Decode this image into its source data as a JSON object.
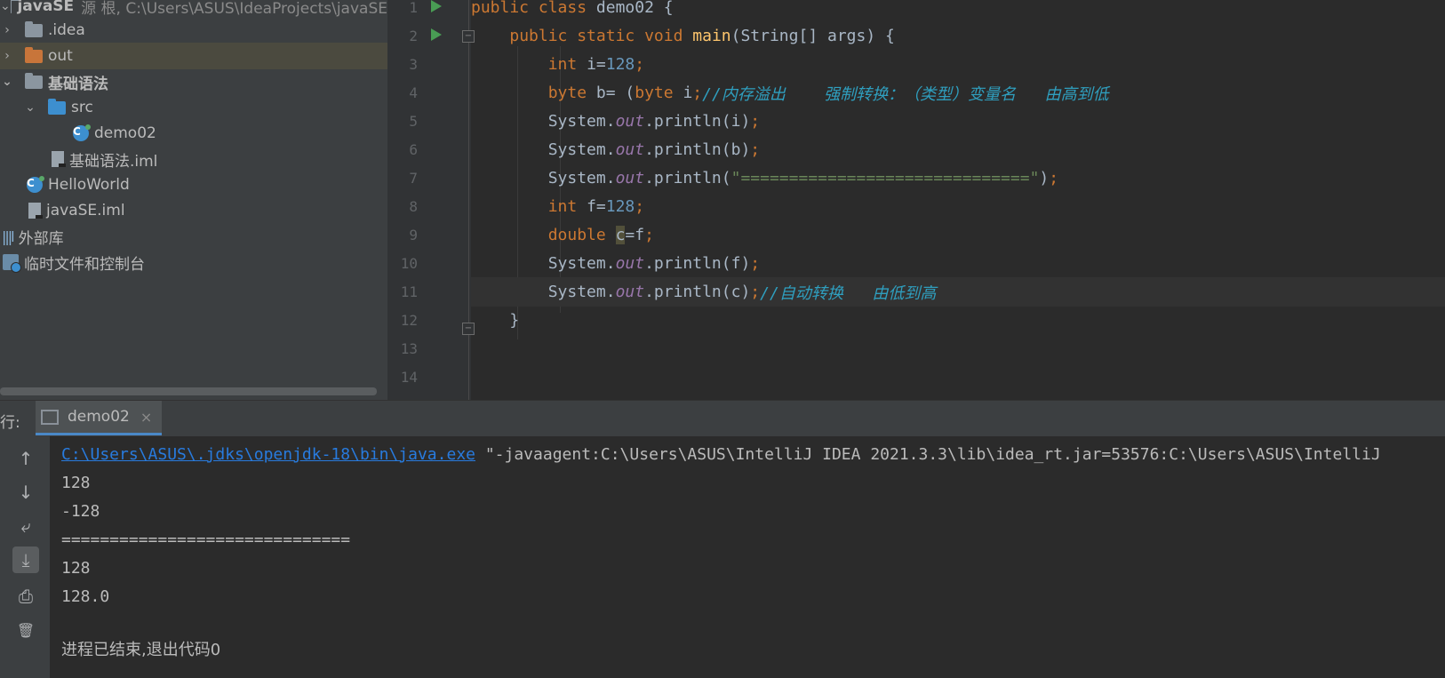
{
  "project_tree": {
    "root": {
      "name": "javaSE",
      "path": "源 根,  C:\\Users\\ASUS\\IdeaProjects\\javaSE"
    },
    "items": [
      {
        "label": ".idea"
      },
      {
        "label": "out"
      },
      {
        "label": "基础语法"
      },
      {
        "label": "src"
      },
      {
        "label": "demo02"
      },
      {
        "label": "基础语法.iml"
      },
      {
        "label": "HelloWorld"
      },
      {
        "label": "javaSE.iml"
      },
      {
        "label": "外部库"
      },
      {
        "label": "临时文件和控制台"
      }
    ]
  },
  "editor": {
    "line_numbers": [
      "1",
      "2",
      "3",
      "4",
      "5",
      "6",
      "7",
      "8",
      "9",
      "10",
      "11",
      "12",
      "13",
      "14"
    ],
    "current_line": "11",
    "lines": [
      {
        "tokens": [
          [
            "kw",
            "public "
          ],
          [
            "kw",
            "class "
          ],
          [
            "",
            "demo02 {"
          ]
        ]
      },
      {
        "tokens": [
          [
            "",
            "    "
          ],
          [
            "kw",
            "public "
          ],
          [
            "kw",
            "static "
          ],
          [
            "kw",
            "void "
          ],
          [
            "fn",
            "main"
          ],
          [
            "",
            "(String[] args) {"
          ]
        ]
      },
      {
        "tokens": [
          [
            "",
            "        "
          ],
          [
            "kw",
            "int "
          ],
          [
            "",
            "i="
          ],
          [
            "num",
            "128"
          ],
          [
            "kw",
            ";"
          ]
        ]
      },
      {
        "tokens": [
          [
            "",
            "        "
          ],
          [
            "kw",
            "byte "
          ],
          [
            "",
            "b= ("
          ],
          [
            "kw",
            "byte"
          ],
          [
            "",
            " i"
          ],
          [
            "kw",
            ";"
          ],
          [
            "cmt",
            "//内存溢出    强制转换：（类型）变量名   由高到低"
          ]
        ]
      },
      {
        "tokens": [
          [
            "",
            "        System."
          ],
          [
            "fld",
            "out"
          ],
          [
            "",
            ".println(i)"
          ],
          [
            "kw",
            ";"
          ]
        ]
      },
      {
        "tokens": [
          [
            "",
            "        System."
          ],
          [
            "fld",
            "out"
          ],
          [
            "",
            ".println(b)"
          ],
          [
            "kw",
            ";"
          ]
        ]
      },
      {
        "tokens": [
          [
            "",
            "        System."
          ],
          [
            "fld",
            "out"
          ],
          [
            "",
            ".println("
          ],
          [
            "str",
            "\"==============================\""
          ],
          [
            "",
            ")"
          ],
          [
            "kw",
            ";"
          ]
        ]
      },
      {
        "tokens": [
          [
            "",
            "        "
          ],
          [
            "kw",
            "int "
          ],
          [
            "",
            "f="
          ],
          [
            "num",
            "128"
          ],
          [
            "kw",
            ";"
          ]
        ]
      },
      {
        "tokens": [
          [
            "",
            "        "
          ],
          [
            "kw",
            "double "
          ],
          [
            "hl",
            "c"
          ],
          [
            "",
            "=f"
          ],
          [
            "kw",
            ";"
          ]
        ]
      },
      {
        "tokens": [
          [
            "",
            "        System."
          ],
          [
            "fld",
            "out"
          ],
          [
            "",
            ".println(f)"
          ],
          [
            "kw",
            ";"
          ]
        ]
      },
      {
        "tokens": [
          [
            "",
            "        System."
          ],
          [
            "fld",
            "out"
          ],
          [
            "",
            ".println(c)"
          ],
          [
            "kw",
            ";"
          ],
          [
            "cmt",
            "//自动转换   由低到高"
          ]
        ]
      },
      {
        "tokens": [
          [
            "",
            "    }"
          ]
        ]
      },
      {
        "tokens": []
      },
      {
        "tokens": []
      }
    ]
  },
  "run_panel": {
    "label": "行:",
    "tab_label": "demo02",
    "tab_close": "×",
    "command_link": "C:\\Users\\ASUS\\.jdks\\openjdk-18\\bin\\java.exe",
    "command_rest": " \"-javaagent:C:\\Users\\ASUS\\IntelliJ IDEA 2021.3.3\\lib\\idea_rt.jar=53576:C:\\Users\\ASUS\\IntelliJ",
    "output": [
      "128",
      "-128",
      "==============================",
      "128",
      "128.0",
      ""
    ],
    "exit_message": "进程已结束,退出代码0"
  },
  "sidebar_buttons": [
    {
      "icon": "arrow-up-icon",
      "glyph": "↑"
    },
    {
      "icon": "arrow-down-icon",
      "glyph": "↓"
    },
    {
      "icon": "soft-wrap-icon",
      "glyph": "⤶"
    },
    {
      "icon": "scroll-to-end-icon",
      "glyph": "⤓"
    },
    {
      "icon": "print-icon",
      "glyph": "⎙"
    },
    {
      "icon": "trash-icon",
      "glyph": "🗑"
    }
  ],
  "colors": {
    "keyword": "#cc7832",
    "number": "#6897bb",
    "string": "#6a8759",
    "comment": "#2f9fbf",
    "link": "#287bde",
    "run_marker": "#499c54"
  }
}
